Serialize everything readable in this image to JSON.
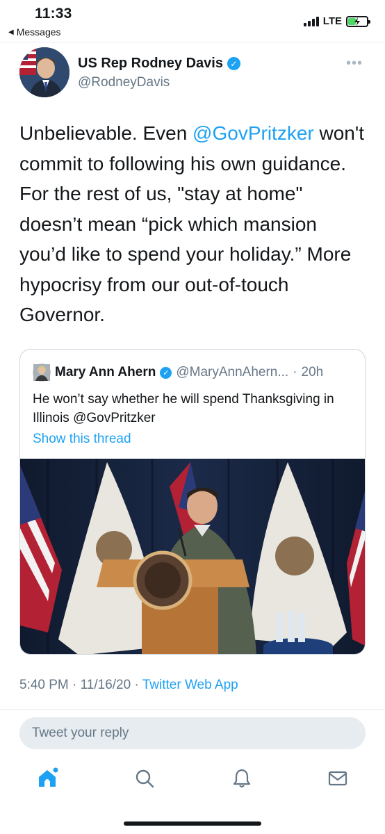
{
  "status_bar": {
    "time": "11:33",
    "back_label": "Messages",
    "network": "LTE"
  },
  "tweet": {
    "author_name": "US Rep Rodney Davis",
    "author_handle": "@RodneyDavis",
    "text_parts": [
      "Unbelievable. Even ",
      "@GovPritzker",
      " won't commit to following his own guidance. For the rest of us, \"stay at home\" doesn’t mean “pick which mansion you’d like to spend your holiday.” More hypocrisy from our out-of-touch Governor."
    ],
    "timestamp": "5:40 PM · 11/16/20 · ",
    "source_app": "Twitter Web App"
  },
  "quoted_tweet": {
    "author_name": "Mary Ann Ahern",
    "author_handle": "@MaryAnnAhern...",
    "separator": "·",
    "time_ago": "20h",
    "text": "He won’t say whether he will spend Thanksgiving in Illinois @GovPritzker",
    "show_thread": "Show this thread"
  },
  "reply": {
    "placeholder": "Tweet your reply"
  },
  "colors": {
    "accent": "#1da1f2",
    "secondary_text": "#657786"
  },
  "tabs": [
    "home-icon",
    "search-icon",
    "notifications-icon",
    "messages-icon"
  ]
}
